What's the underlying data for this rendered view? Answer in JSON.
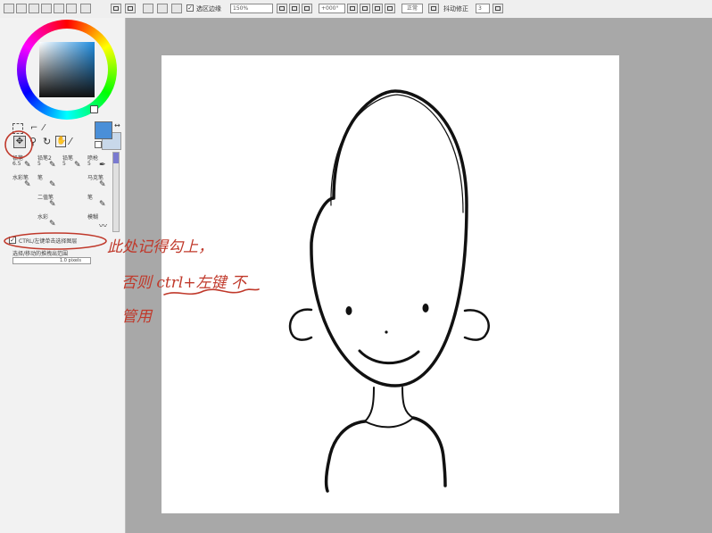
{
  "toolbar": {
    "checkbox_label": "选区边缘",
    "zoom_value": "150%",
    "rotation_value": "+000°",
    "blend_mode": "正常",
    "stabilizer_label": "抖动修正",
    "stabilizer_value": "3"
  },
  "tool_panel": {
    "brushes": [
      {
        "name": "铅笔",
        "size": "6.5"
      },
      {
        "name": "铅笔2",
        "size": "5"
      },
      {
        "name": "铅笔",
        "size": "5"
      },
      {
        "name": "喷枪",
        "size": "5"
      },
      {
        "name": "水彩笔",
        "size": ""
      },
      {
        "name": "笔",
        "size": ""
      },
      {
        "name": "马克笔",
        "size": ""
      },
      {
        "name": "二值笔",
        "size": ""
      },
      {
        "name": "笔",
        "size": ""
      },
      {
        "name": "水彩",
        "size": ""
      },
      {
        "name": "模糊",
        "size": ""
      }
    ],
    "ctrl_checkbox_label": "CTRL/左键单击选择图层",
    "selection_label": "选择/移动的推拽出范围",
    "selection_value": "1.0 pixels"
  },
  "annotation": {
    "line1": "此处记得勾上，",
    "line2": "否则 ctrl+左键 不",
    "line3": "管用"
  },
  "colors": {
    "primary": "#4a8fd8",
    "secondary": "#c8d8ea",
    "annotation": "#c0392b"
  }
}
